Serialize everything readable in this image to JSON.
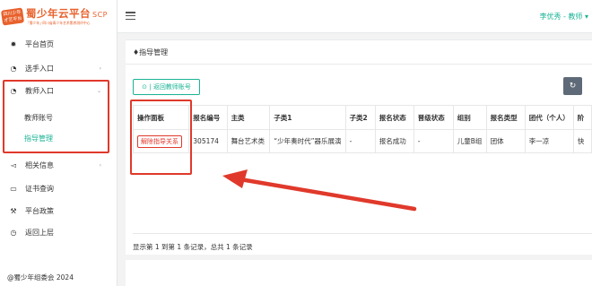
{
  "logo": {
    "badge": "四川少年 才艺平台",
    "title": "蜀少年云平台",
    "suffix": "SCP",
    "subtitle": "「蜀少年」·四川省青少年艺术素养测评中心"
  },
  "sidebar": {
    "items": [
      {
        "label": "平台首页",
        "icon": "gear-icon"
      },
      {
        "label": "选手入口",
        "icon": "pie-icon",
        "arrow": "›"
      },
      {
        "label": "教师入口",
        "icon": "pie-icon",
        "arrow": "⌄"
      },
      {
        "label": "相关信息",
        "icon": "megaphone-icon",
        "arrow": "›"
      },
      {
        "label": "证书查询",
        "icon": "certificate-icon"
      },
      {
        "label": "平台政策",
        "icon": "gavel-icon"
      },
      {
        "label": "返回上层",
        "icon": "history-icon"
      }
    ],
    "sub_items": [
      {
        "label": "教师账号"
      },
      {
        "label": "指导管理"
      }
    ],
    "copyright": "@蜀少年组委会 2024"
  },
  "topbar": {
    "user": "李优秀 - 教师 ▾"
  },
  "panel": {
    "title": "指导管理",
    "back_button": "⊙ | 返回教师账号",
    "refresh_icon": "↻"
  },
  "table": {
    "headers": [
      "操作面板",
      "报名编号",
      "主类",
      "子类1",
      "子类2",
      "报名状态",
      "晋级状态",
      "组别",
      "报名类型",
      "团代（个人）",
      "阶"
    ],
    "rows": [
      {
        "action": "解除指导关系",
        "cells": [
          "305174",
          "舞台艺术类",
          "“少年奏时代”器乐展演",
          "-",
          "报名成功",
          "-",
          "儿童B组",
          "团体",
          "李一凉",
          "快"
        ]
      }
    ],
    "footer": "显示第 1 到第 1 条记录，总共 1 条记录"
  },
  "colors": {
    "accent": "#1ab394",
    "brand": "#e8612c",
    "annotation": "#e0392b"
  }
}
